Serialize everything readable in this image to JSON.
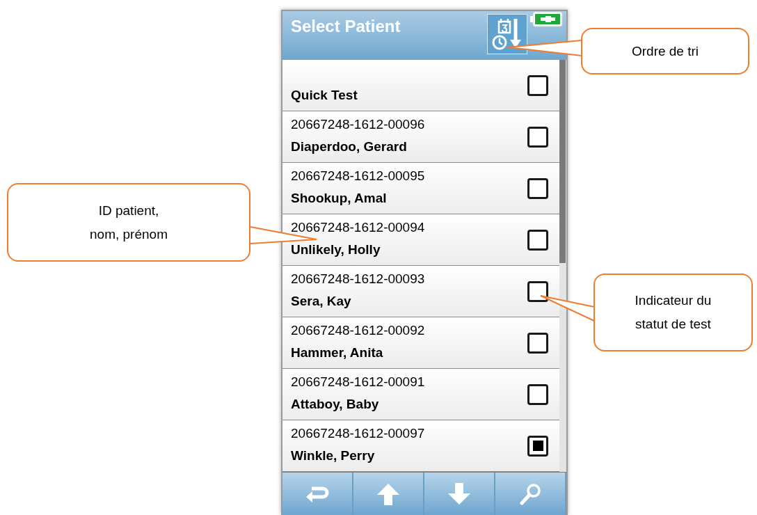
{
  "header": {
    "title": "Select Patient"
  },
  "patients": [
    {
      "name": "Quick Test",
      "checked": false
    },
    {
      "id": "20667248-1612-00096",
      "name": "Diaperdoo, Gerard",
      "checked": false
    },
    {
      "id": "20667248-1612-00095",
      "name": "Shookup, Amal",
      "checked": false
    },
    {
      "id": "20667248-1612-00094",
      "name": "Unlikely, Holly",
      "checked": false
    },
    {
      "id": "20667248-1612-00093",
      "name": "Sera, Kay",
      "checked": false
    },
    {
      "id": "20667248-1612-00092",
      "name": "Hammer, Anita",
      "checked": false
    },
    {
      "id": "20667248-1612-00091",
      "name": "Attaboy, Baby",
      "checked": false
    },
    {
      "id": "20667248-1612-00097",
      "name": "Winkle, Perry",
      "checked": true
    }
  ],
  "callouts": [
    {
      "lines": [
        "Ordre de tri"
      ]
    },
    {
      "lines": [
        "ID patient,",
        "nom, prénom"
      ]
    },
    {
      "lines": [
        "Indicateur du",
        "statut de test"
      ]
    }
  ]
}
